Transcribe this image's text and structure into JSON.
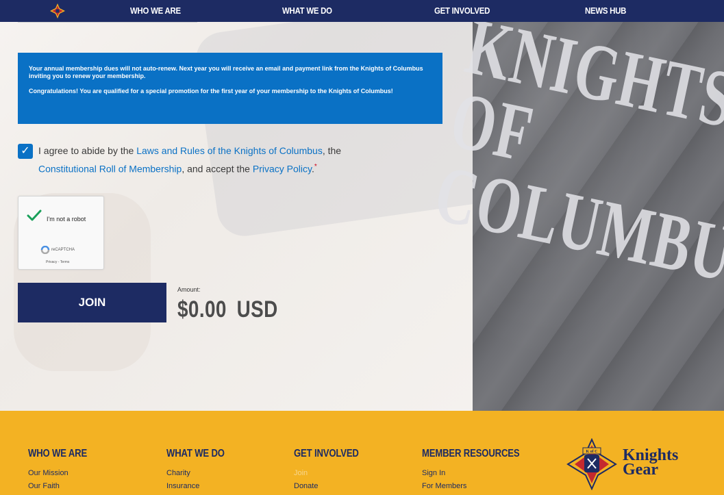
{
  "nav": {
    "items": [
      "WHO WE ARE",
      "WHAT WE DO",
      "GET INVOLVED",
      "NEWS HUB"
    ]
  },
  "notice": {
    "line1": "Your annual membership dues will not auto-renew. Next year you will receive an email and payment link from the Knights of Columbus inviting you to renew your membership.",
    "line2": "Congratulations! You are qualified for a special promotion for the first year of your membership to the Knights of Columbus!"
  },
  "agreement": {
    "checked": true,
    "text_before": "I agree to abide by the ",
    "link1": "Laws and Rules of the Knights of Columbus",
    "text_mid1": ", the ",
    "link2": "Constitutional Roll of Membership",
    "text_mid2": ", and accept the ",
    "link3": "Privacy Policy",
    "text_end": ".",
    "required_mark": "*"
  },
  "recaptcha": {
    "label": "I'm not a robot",
    "brand": "reCAPTCHA",
    "links": "Privacy - Terms"
  },
  "join_button": "JOIN",
  "amount": {
    "label": "Amount:",
    "value": "$0.00",
    "currency": "USD"
  },
  "background_shirt_text": "KNIGHTS OF COLUMBUS",
  "footer": {
    "columns": [
      {
        "heading": "WHO WE ARE",
        "items": [
          "Our Mission",
          "Our Faith"
        ]
      },
      {
        "heading": "WHAT WE DO",
        "items": [
          "Charity",
          "Insurance"
        ]
      },
      {
        "heading": "GET INVOLVED",
        "items": [
          "Join",
          "Donate"
        ]
      },
      {
        "heading": "MEMBER RESOURCES",
        "items": [
          "Sign In",
          "For Members"
        ]
      }
    ],
    "brand": {
      "line1": "Knights",
      "line2": "Gear",
      "emblem_text": "K of C"
    }
  },
  "colors": {
    "navy": "#1d2b63",
    "blue": "#0a71c5",
    "gold": "#f3b223",
    "required": "#d0021b"
  }
}
